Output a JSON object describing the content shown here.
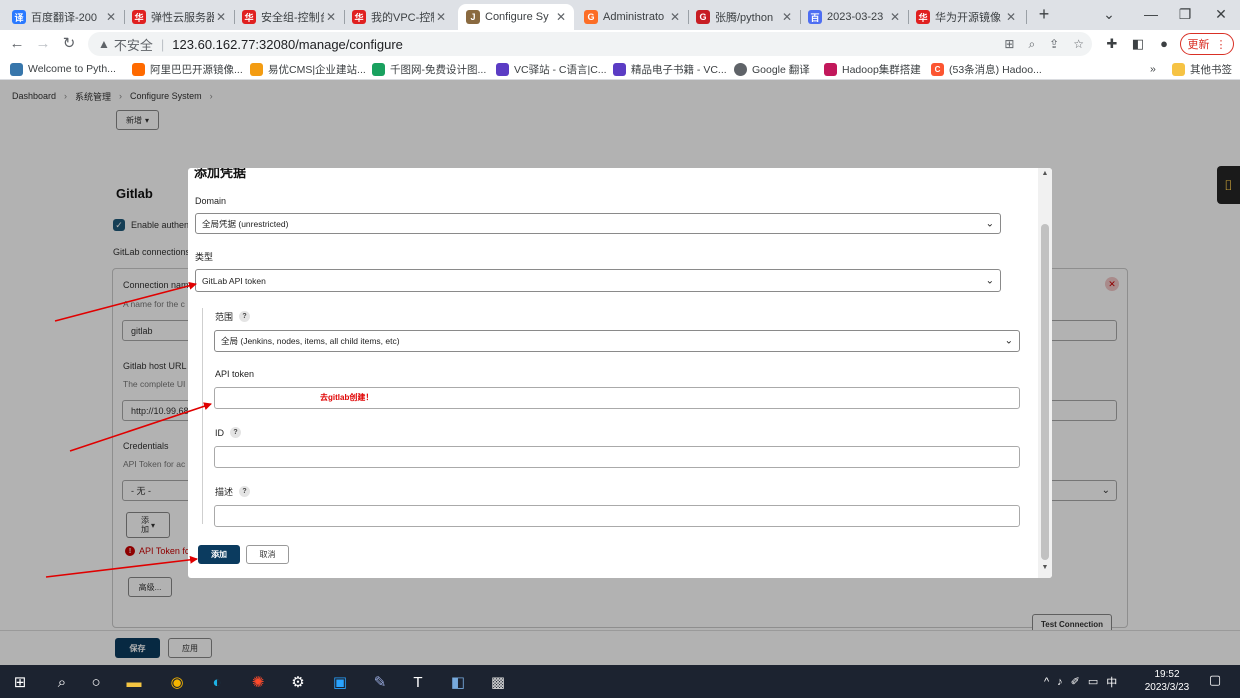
{
  "browser": {
    "tabs": [
      {
        "label": "百度翻译-200",
        "icon_color": "#2979ff",
        "icon_glyph": "译",
        "active": false
      },
      {
        "label": "弹性云服务器",
        "icon_color": "#e02020",
        "icon_glyph": "华",
        "active": false
      },
      {
        "label": "安全组-控制台",
        "icon_color": "#e02020",
        "icon_glyph": "华",
        "active": false
      },
      {
        "label": "我的VPC-控制",
        "icon_color": "#e02020",
        "icon_glyph": "华",
        "active": false
      },
      {
        "label": "Configure Sy",
        "icon_color": "#8a6a40",
        "icon_glyph": "J",
        "active": true
      },
      {
        "label": "Administrato",
        "icon_color": "#fc6d26",
        "icon_glyph": "G",
        "active": false
      },
      {
        "label": "张腾/python",
        "icon_color": "#c71d23",
        "icon_glyph": "G",
        "active": false
      },
      {
        "label": "2023-03-23",
        "icon_color": "#4e6ef2",
        "icon_glyph": "百",
        "active": false
      },
      {
        "label": "华为开源镜像",
        "icon_color": "#e02020",
        "icon_glyph": "华",
        "active": false
      }
    ],
    "address": {
      "insecure_label": "不安全",
      "url": "123.60.162.77:32080/manage/configure"
    },
    "update_label": "更新",
    "bookmarks": [
      {
        "label": "Welcome to Pyth...",
        "icon_color": "#3776ab"
      },
      {
        "label": "阿里巴巴开源镜像...",
        "icon_color": "#ff6a00"
      },
      {
        "label": "易优CMS|企业建站...",
        "icon_color": "#f39c12"
      },
      {
        "label": "千图网-免费设计图...",
        "icon_color": "#19a15f"
      },
      {
        "label": "VC驿站 - C语言|C...",
        "icon_color": "#5b3cc4"
      },
      {
        "label": "精品电子书籍 - VC...",
        "icon_color": "#5b3cc4"
      },
      {
        "label": "Google 翻译",
        "icon_color": "#5f6368"
      },
      {
        "label": "Hadoop集群搭建",
        "icon_color": "#c2185b"
      },
      {
        "label": "(53条消息) Hadoo...",
        "icon_color": "#fc5531"
      }
    ],
    "other_bookmarks": "其他书签"
  },
  "page": {
    "breadcrumb": [
      "Dashboard",
      "系统管理",
      "Configure System"
    ],
    "new_button": "新增",
    "gitlab_heading": "Gitlab",
    "enable_auth": "Enable authen",
    "gitlab_connections": "GitLab connections",
    "connection_name_label": "Connection nam",
    "connection_name_help": "A name for the c",
    "connection_name_value": "gitlab",
    "host_url_label": "Gitlab host URL",
    "host_url_help": "The complete UI",
    "host_url_value": "http://10.99.68",
    "credentials_label": "Credentials",
    "credentials_help": "API Token for ac",
    "credentials_value": "- 无 -",
    "add_button": "添\n加",
    "error_text": "API Token fc",
    "advanced_button": "高级...",
    "test_connection": "Test Connection",
    "save_button": "保存",
    "apply_button": "应用"
  },
  "modal": {
    "title": "添加凭据",
    "domain_label": "Domain",
    "domain_value": "全局凭据 (unrestricted)",
    "kind_label": "类型",
    "kind_value": "GitLab API token",
    "scope_label": "范围",
    "scope_value": "全局 (Jenkins, nodes, items, all child items, etc)",
    "token_label": "API token",
    "token_annotation": "去gitlab创建！",
    "id_label": "ID",
    "desc_label": "描述",
    "help_glyph": "?",
    "add_button": "添加",
    "cancel_button": "取消"
  },
  "taskbar": {
    "ime": "中",
    "time": "19:52",
    "date": "2023/3/23"
  },
  "colors": {
    "jenkins_primary": "#0b3b5f",
    "annotation_red": "#e00000",
    "error_red": "#cc0000"
  }
}
